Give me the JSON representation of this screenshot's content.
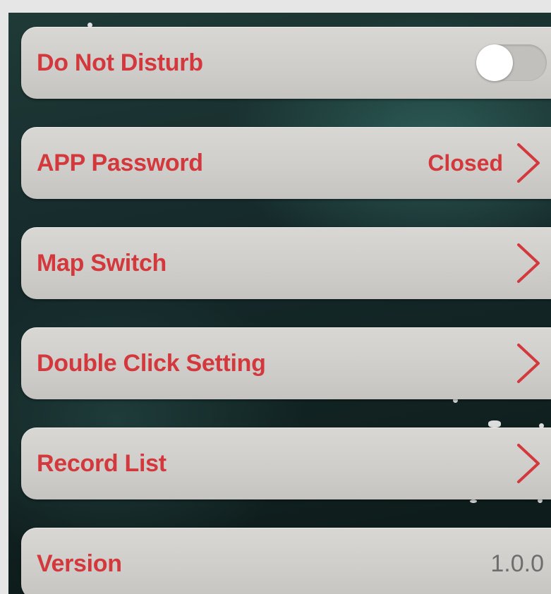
{
  "settings": {
    "do_not_disturb": {
      "label": "Do Not Disturb",
      "enabled": false
    },
    "app_password": {
      "label": "APP Password",
      "value": "Closed"
    },
    "map_switch": {
      "label": "Map Switch"
    },
    "double_click": {
      "label": "Double Click Setting"
    },
    "record_list": {
      "label": "Record List"
    },
    "version": {
      "label": "Version",
      "value": "1.0.0"
    }
  },
  "colors": {
    "label_red": "#d2383c",
    "row_background": "#cfcdca",
    "background_teal": "#1f3a37",
    "version_gray": "#6e6e6e"
  },
  "icons": {
    "chevron": "chevron-right-icon",
    "toggle": "toggle-switch"
  }
}
